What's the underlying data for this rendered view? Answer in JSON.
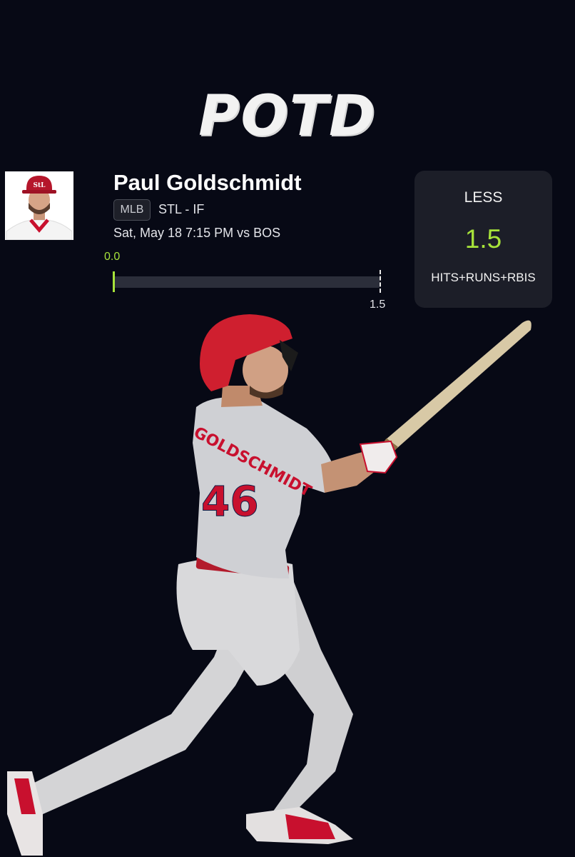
{
  "header": {
    "title": "POTD"
  },
  "player": {
    "name": "Paul Goldschmidt",
    "league": "MLB",
    "team_position": "STL - IF",
    "game_time": "Sat, May 18 7:15 PM  vs BOS",
    "jersey_name": "GOLDSCHMIDT",
    "jersey_number": "46"
  },
  "progress": {
    "current": "0.0",
    "target": "1.5",
    "fraction": 0
  },
  "pick": {
    "direction": "LESS",
    "line": "1.5",
    "stat": "HITS+RUNS+RBIS"
  },
  "colors": {
    "background": "#070915",
    "accent": "#a7e33a",
    "card": "#1c1e28",
    "cardinals_red": "#c8102e"
  },
  "icons": {
    "headshot": "player-headshot",
    "photo": "player-batting-photo"
  }
}
